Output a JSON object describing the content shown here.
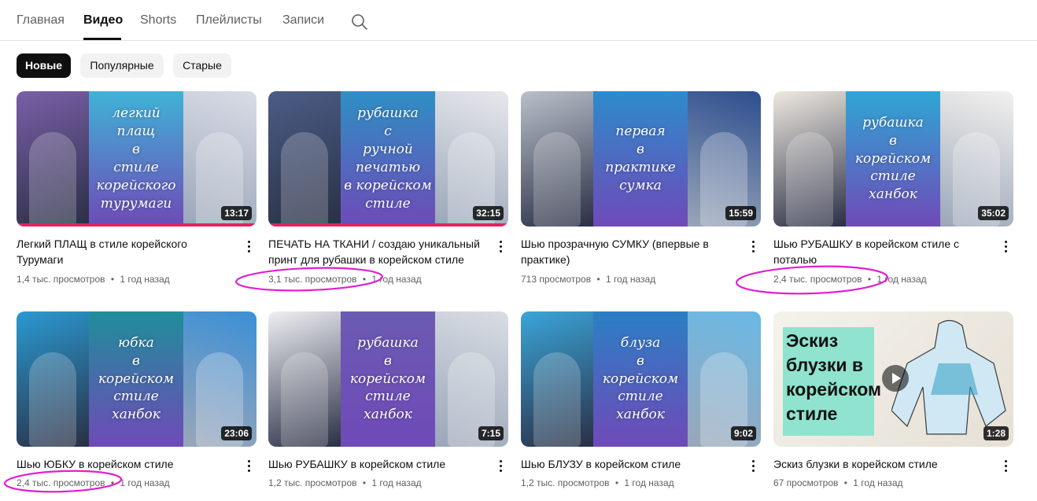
{
  "tabs": [
    "Главная",
    "Видео",
    "Shorts",
    "Плейлисты",
    "Записи"
  ],
  "chips": [
    "Новые",
    "Популярные",
    "Старые"
  ],
  "videos": [
    {
      "title": "Легкий ПЛАЩ в стиле корейского Турумаги",
      "views": "1,4 тыс. просмотров",
      "age": "1 год назад",
      "duration": "13:17",
      "thumb_text": "легкий\nплащ\nв\nстиле\nкорейского\nтурумаги",
      "colors": [
        "#7a5fa8",
        "#3fb3d6",
        "#d9dce6"
      ]
    },
    {
      "title": "ПЕЧАТЬ НА ТКАНИ / создаю уникальный принт для рубашки в корейском стиле",
      "views": "3,1 тыс. просмотров",
      "age": "1 год назад",
      "duration": "32:15",
      "thumb_text": "рубашка\nс\nручной\nпечатью\nв корейском стиле",
      "colors": [
        "#4b5d86",
        "#2e8fc4",
        "#e7e8ec"
      ]
    },
    {
      "title": "Шью прозрачную СУМКУ (впервые в практике)",
      "views": "713 просмотров",
      "age": "1 год назад",
      "duration": "15:59",
      "thumb_text": "первая\nв\nпрактике\nсумка",
      "colors": [
        "#b9c0c9",
        "#2d8bcb",
        "#2d4e8f"
      ]
    },
    {
      "title": "Шью РУБАШКУ в корейском стиле с поталью",
      "views": "2,4 тыс. просмотров",
      "age": "1 год назад",
      "duration": "35:02",
      "thumb_text": "рубашка\nв\nкорейском\nстиле\nханбок",
      "colors": [
        "#efe9e0",
        "#2fa6d4",
        "#f3f1ee"
      ]
    },
    {
      "title": "Шью ЮБКУ в корейском стиле",
      "views": "2,4 тыс. просмотров",
      "age": "1 год назад",
      "duration": "23:06",
      "thumb_text": "юбка\nв\nкорейском\nстиле\nханбок",
      "colors": [
        "#2a9ad1",
        "#1f8e9b",
        "#3b8fd6"
      ]
    },
    {
      "title": "Шью РУБАШКУ в корейском стиле",
      "views": "1,2 тыс. просмотров",
      "age": "1 год назад",
      "duration": "7:15",
      "thumb_text": "рубашка\nв\nкорейском\nстиле\nханбок",
      "colors": [
        "#eef0f3",
        "#6b5bb2",
        "#d9dde4"
      ]
    },
    {
      "title": "Шью БЛУЗУ в корейском стиле",
      "views": "1,2 тыс. просмотров",
      "age": "1 год назад",
      "duration": "9:02",
      "thumb_text": "блуза\nв\nкорейском\nстиле\nханбок",
      "colors": [
        "#3aa5d9",
        "#2b7fc4",
        "#69b9e6"
      ]
    },
    {
      "title": "Эскиз блузки в корейском стиле",
      "views": "67 просмотров",
      "age": "1 год назад",
      "duration": "1:28",
      "thumb_text": "Эскиз\nблузки в\nкорейском\nстиле",
      "colors": [
        "#f0efea",
        "#f0efea",
        "#e9e4dc"
      ]
    }
  ],
  "meta_separator": "•",
  "colors": {
    "annotation": "#e020d0",
    "progress": "#e0245e"
  }
}
